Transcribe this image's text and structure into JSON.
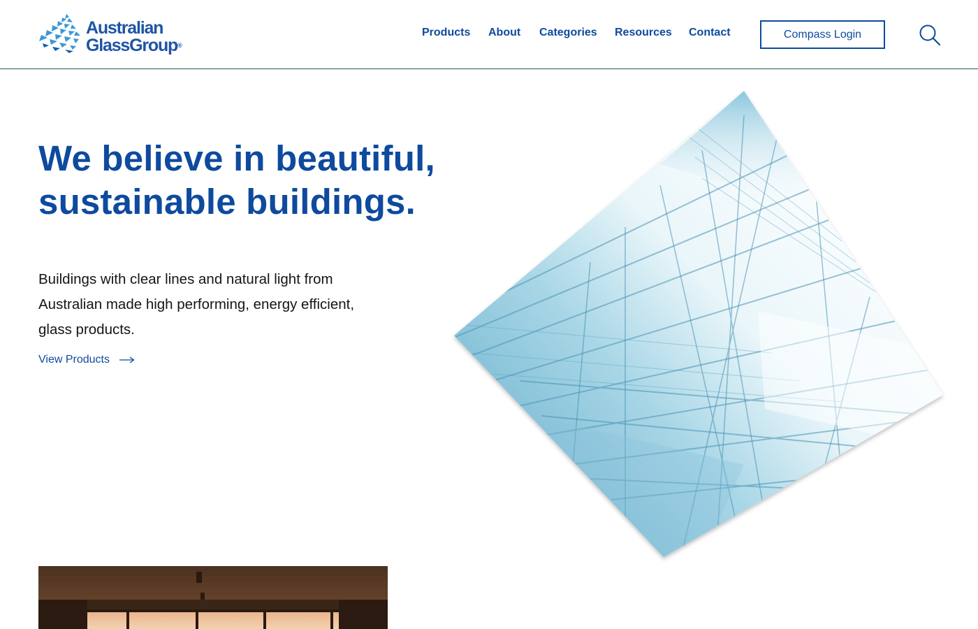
{
  "brand": {
    "logo_line1": "Australian",
    "logo_line2": "GlassGroup",
    "logo_reg": "®",
    "primary_color": "#0e4a9e",
    "logo_color": "#1f55a5"
  },
  "nav": {
    "items": [
      {
        "label": "Products"
      },
      {
        "label": "About"
      },
      {
        "label": "Categories"
      },
      {
        "label": "Resources"
      },
      {
        "label": "Contact"
      }
    ],
    "login_label": "Compass Login",
    "search_icon": "search-icon"
  },
  "hero": {
    "title_line1": "We believe in beautiful,",
    "title_line2": "sustainable buildings.",
    "body": "Buildings with clear lines and natural light from Australian made high performing, energy efficient, glass products.",
    "cta_label": "View Products",
    "cta_icon": "arrow-right-icon"
  }
}
